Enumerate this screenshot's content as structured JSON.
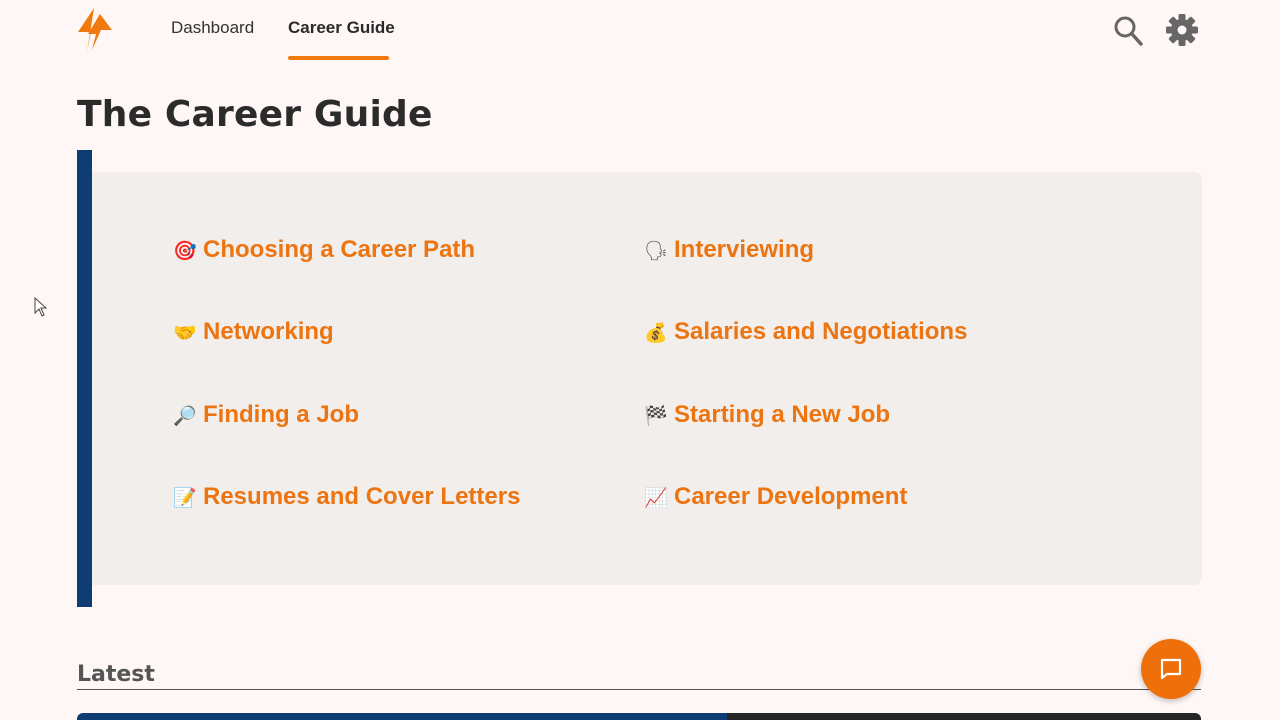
{
  "nav": {
    "dashboard_label": "Dashboard",
    "career_guide_label": "Career Guide",
    "active": "Career Guide"
  },
  "page": {
    "title": "The Career Guide"
  },
  "guide_links": {
    "left": [
      {
        "emoji": "🎯",
        "label": "Choosing a Career Path"
      },
      {
        "emoji": "🤝",
        "label": "Networking"
      },
      {
        "emoji": "🔎",
        "label": "Finding a Job"
      },
      {
        "emoji": "📝",
        "label": "Resumes and Cover Letters"
      }
    ],
    "right": [
      {
        "emoji": "🗣",
        "label": "Interviewing"
      },
      {
        "emoji": "💰",
        "label": "Salaries and Negotiations"
      },
      {
        "emoji": "🏁",
        "label": "Starting a New Job"
      },
      {
        "emoji": "📈",
        "label": "Career Development"
      }
    ]
  },
  "latest": {
    "heading": "Latest"
  },
  "colors": {
    "accent": "#ec7411",
    "brand_navy": "#0f3c73",
    "background": "#fff7f5",
    "panel": "#f2eeeb"
  },
  "icons": {
    "logo": "lightning-bolt-logo",
    "search": "search-icon",
    "settings": "gear-icon",
    "chat": "chat-bubble-icon"
  }
}
